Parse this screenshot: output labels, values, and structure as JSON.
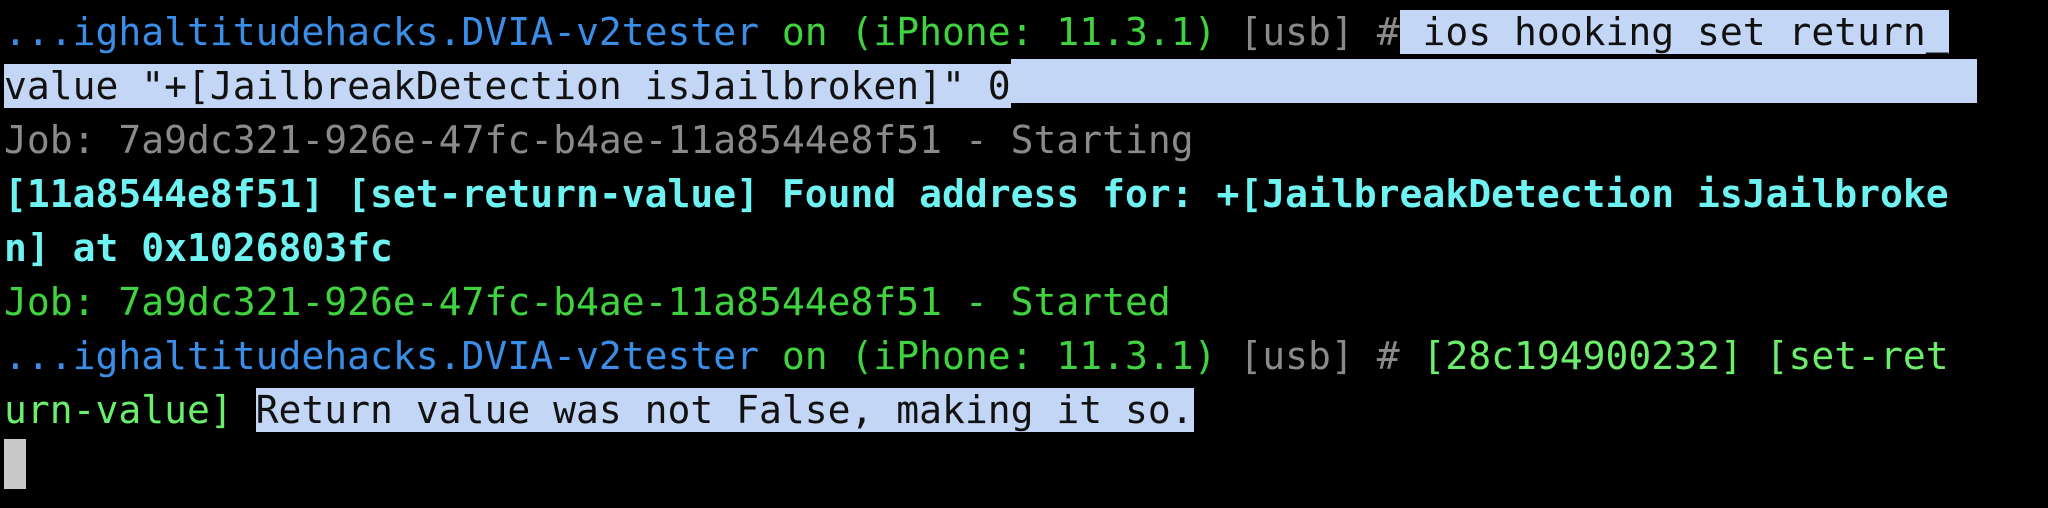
{
  "colors": {
    "background": "#000000",
    "prompt_device": "#3b8ee8",
    "prompt_on": "#3fd43f",
    "prompt_usb": "#8a8a8a",
    "job_starting": "#8a8a8a",
    "job_started": "#3fd43f",
    "found_address": "#6ef2f2",
    "set_return_value_log": "#6bee6b",
    "selection": "#c3d6f5",
    "cursor": "#c8c8c8"
  },
  "prompt1": {
    "device": "...ighaltitudehacks.DVIA-v2tester",
    "on_device": " on (iPhone: 11.3.1)",
    "usb": " [usb] ",
    "hash": "#",
    "command_part1": " ios hooking set return_",
    "command_part2": "value \"+[JailbreakDetection isJailbroken]\" 0"
  },
  "job_starting": "Job: 7a9dc321-926e-47fc-b4ae-11a8544e8f51 - Starting",
  "found_line1": "[11a8544e8f51] [set-return-value] Found address for: +[JailbreakDetection isJailbroke",
  "found_line2": "n] at 0x1026803fc",
  "job_started": "Job: 7a9dc321-926e-47fc-b4ae-11a8544e8f51 - Started",
  "prompt2": {
    "device": "...ighaltitudehacks.DVIA-v2tester",
    "on_device": " on (iPhone: 11.3.1)",
    "usb": " [usb] ",
    "hash": "# ",
    "log_part1": "[28c194900232] [set-ret",
    "log_part2": "urn-value] ",
    "message": "Return value was not False, making it so."
  },
  "cursor_icon": "block-cursor"
}
